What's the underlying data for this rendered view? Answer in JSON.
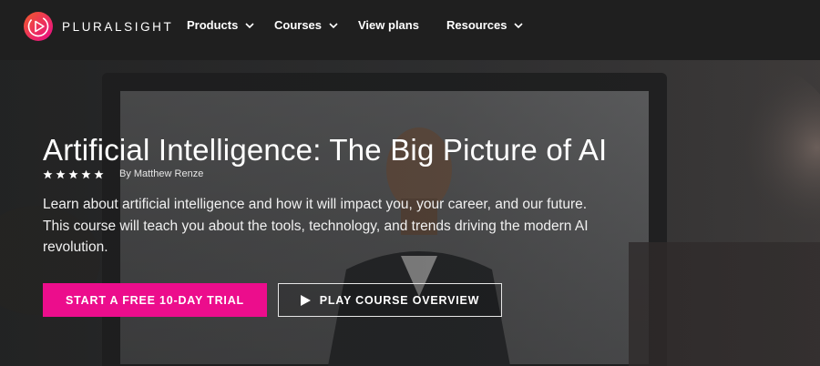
{
  "brand": {
    "name": "PLURALSIGHT",
    "logo_icon": "play-triangle-icon",
    "gradient": [
      "#f15b2a",
      "#e80a89"
    ]
  },
  "nav": {
    "items": [
      {
        "label": "Products",
        "has_dropdown": true
      },
      {
        "label": "Courses",
        "has_dropdown": true
      },
      {
        "label": "View plans",
        "has_dropdown": false
      },
      {
        "label": "Resources",
        "has_dropdown": true
      }
    ]
  },
  "course": {
    "title": "Artificial Intelligence: The Big Picture of AI",
    "rating_stars": 5,
    "author": "By Matthew Renze",
    "description": "Learn about artificial intelligence and how it will impact you, your career, and our future. This course will teach you about the tools, technology, and trends driving the modern AI revolution."
  },
  "actions": {
    "trial_label": "START A FREE 10-DAY TRIAL",
    "play_label": "PLAY COURSE OVERVIEW",
    "play_icon": "play-icon"
  },
  "colors": {
    "accent": "#ec0d8c",
    "header_bg": "#1f1f1f"
  }
}
